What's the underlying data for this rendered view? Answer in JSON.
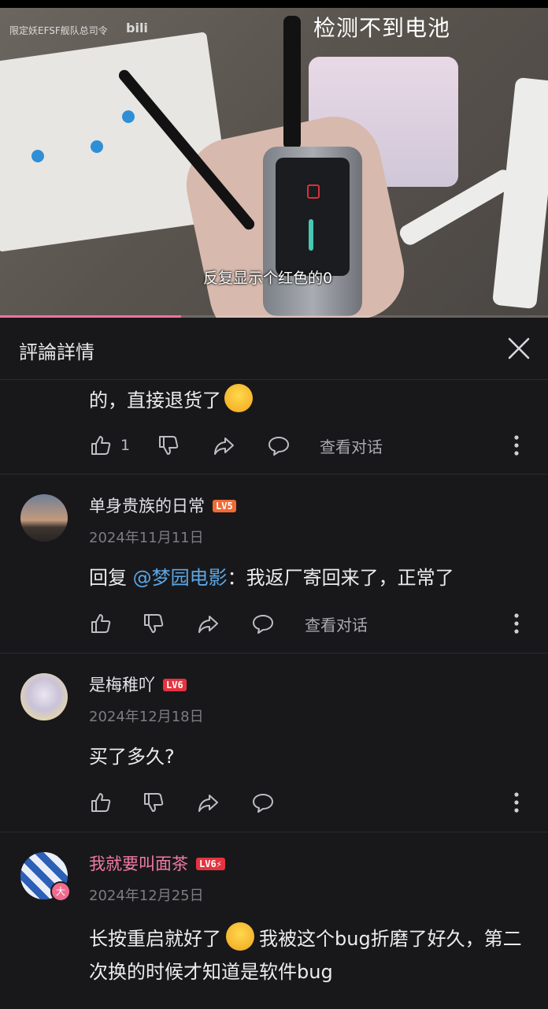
{
  "video": {
    "watermark": "限定妖EFSF舰队总司令",
    "watermark_logo": "bili",
    "overlay_title": "检测不到电池",
    "subtitle": "反复显示个红色的0",
    "progress_fraction": 0.33,
    "progress_color": "#fb7299"
  },
  "header": {
    "title": "評論詳情",
    "close_icon": "close-icon"
  },
  "comments": [
    {
      "body": "的，直接退货了",
      "emoji": "laughing-face-emoji",
      "like_count": "1",
      "view_conversation": "查看对话"
    },
    {
      "username": "单身贵族的日常",
      "level": "LV5",
      "level_color": "#ef6a34",
      "date": "2024年11月11日",
      "reply_prefix": "回复 ",
      "mention": "@梦园电影",
      "body": "：我返厂寄回来了，正常了",
      "view_conversation": "查看对话"
    },
    {
      "username": "是梅稚吖",
      "level": "LV6",
      "level_color": "#e5333f",
      "date": "2024年12月18日",
      "body": "买了多久?"
    },
    {
      "username": "我就要叫面茶",
      "username_color": "#f07aa0",
      "level": "LV6⚡",
      "level_color": "#e5333f",
      "date": "2024年12月25日",
      "body_part1": "长按重启就好了",
      "body_part2": "我被这个bug折磨了好久，第二次换的时候才知道是软件bug",
      "avatar_badge": "大"
    }
  ],
  "colors": {
    "background": "#18181b",
    "mention": "#5ca8e6",
    "muted": "#7c7c82"
  }
}
